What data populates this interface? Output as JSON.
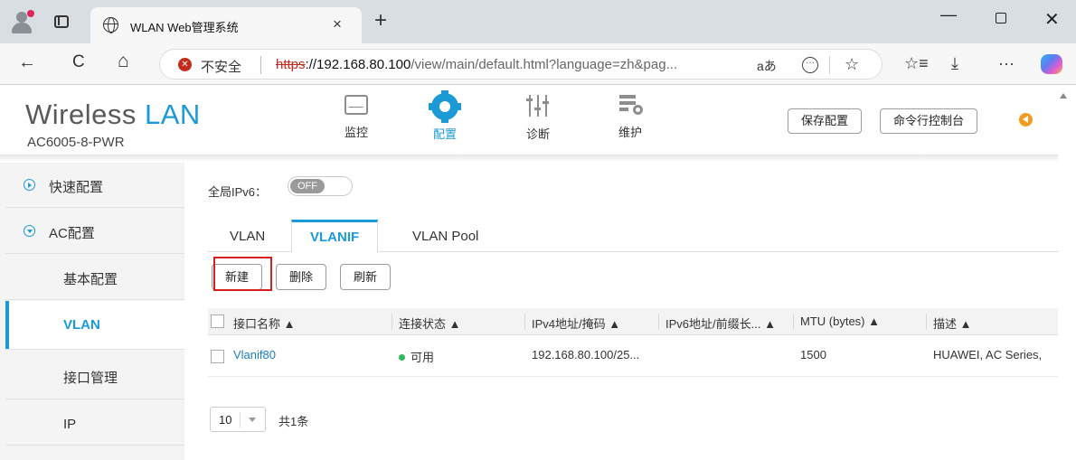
{
  "browser": {
    "tab_title": "WLAN Web管理系统",
    "tab_close": "×",
    "new_tab": "+",
    "win_min": "—",
    "win_close": "✕",
    "back": "←",
    "reload": "C",
    "home": "⌂",
    "warning_glyph": "✕",
    "insecure_label": "不安全",
    "url_scheme": "https",
    "url_host": "://192.168.80.100",
    "url_path": "/view/main/default.html?language=zh&pag...",
    "read_aloud": "aあ",
    "more_in_box": "···",
    "favorite": "☆",
    "favorites_bar": "☆≡",
    "downloads": "⤓",
    "menu": "···"
  },
  "header": {
    "brand_prefix": "Wireless",
    "brand_suffix": "LAN",
    "model": "AC6005-8-PWR",
    "nav": [
      {
        "label": "监控",
        "icon": "monitor-icon"
      },
      {
        "label": "配置",
        "icon": "gear-icon"
      },
      {
        "label": "诊断",
        "icon": "equalizer-icon"
      },
      {
        "label": "维护",
        "icon": "maintenance-icon"
      }
    ],
    "save_config": "保存配置",
    "cli_console": "命令行控制台",
    "accent": "#1b9ad6"
  },
  "sidebar": {
    "items": [
      {
        "label": "快速配置"
      },
      {
        "label": "AC配置"
      },
      {
        "label": "基本配置"
      },
      {
        "label": "VLAN"
      },
      {
        "label": "接口管理"
      },
      {
        "label": "IP"
      }
    ]
  },
  "main": {
    "ipv6_label": "全局IPv6：",
    "ipv6_toggle": "OFF",
    "tabs": [
      {
        "label": "VLAN"
      },
      {
        "label": "VLANIF"
      },
      {
        "label": "VLAN Pool"
      }
    ],
    "actions": {
      "new": "新建",
      "delete": "删除",
      "refresh": "刷新"
    },
    "columns": [
      "接口名称 ▲",
      "连接状态 ▲",
      "IPv4地址/掩码 ▲",
      "IPv6地址/前缀长... ▲",
      "MTU (bytes) ▲",
      "描述 ▲"
    ],
    "rows": [
      {
        "name": "Vlanif80",
        "status": "可用",
        "ipv4": "192.168.80.100/25...",
        "ipv6": "",
        "mtu": "1500",
        "description": "HUAWEI, AC Series,"
      }
    ],
    "page_size": "10",
    "total": "共1条"
  }
}
